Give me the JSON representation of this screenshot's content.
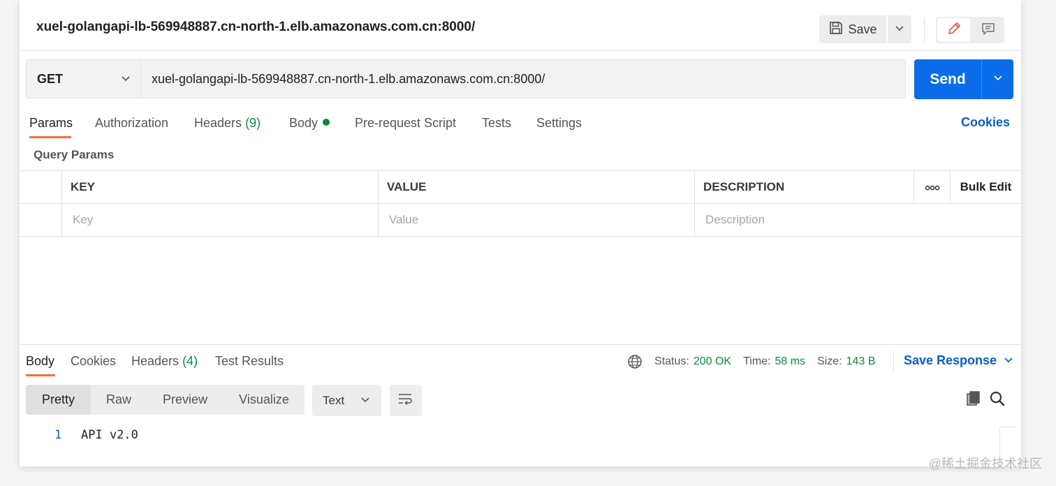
{
  "request": {
    "title": "xuel-golangapi-lb-569948887.cn-north-1.elb.amazonaws.com.cn:8000/",
    "save_label": "Save",
    "method": "GET",
    "url": "xuel-golangapi-lb-569948887.cn-north-1.elb.amazonaws.com.cn:8000/",
    "send_label": "Send"
  },
  "request_tabs": {
    "params": "Params",
    "authorization": "Authorization",
    "headers": "Headers",
    "headers_count": "(9)",
    "body": "Body",
    "prerequest": "Pre-request Script",
    "tests": "Tests",
    "settings": "Settings",
    "cookies": "Cookies"
  },
  "query_params": {
    "label": "Query Params",
    "columns": {
      "key": "KEY",
      "value": "VALUE",
      "description": "DESCRIPTION",
      "bulk_edit": "Bulk Edit"
    },
    "placeholders": {
      "key": "Key",
      "value": "Value",
      "description": "Description"
    }
  },
  "response": {
    "tabs": {
      "body": "Body",
      "cookies": "Cookies",
      "headers": "Headers",
      "headers_count": "(4)",
      "test_results": "Test Results"
    },
    "status_label": "Status:",
    "status_value": "200 OK",
    "time_label": "Time:",
    "time_value": "58 ms",
    "size_label": "Size:",
    "size_value": "143 B",
    "save_response": "Save Response",
    "formats": {
      "pretty": "Pretty",
      "raw": "Raw",
      "preview": "Preview",
      "visualize": "Visualize"
    },
    "text_type": "Text",
    "lines": [
      {
        "number": "1",
        "text": "API v2.0"
      }
    ]
  },
  "watermark": "@稀土掘金技术社区",
  "colors": {
    "accent": "#0a6ce9",
    "active_tab": "#ff6c37",
    "success": "#0b8a3a",
    "link": "#0a5cc7"
  }
}
